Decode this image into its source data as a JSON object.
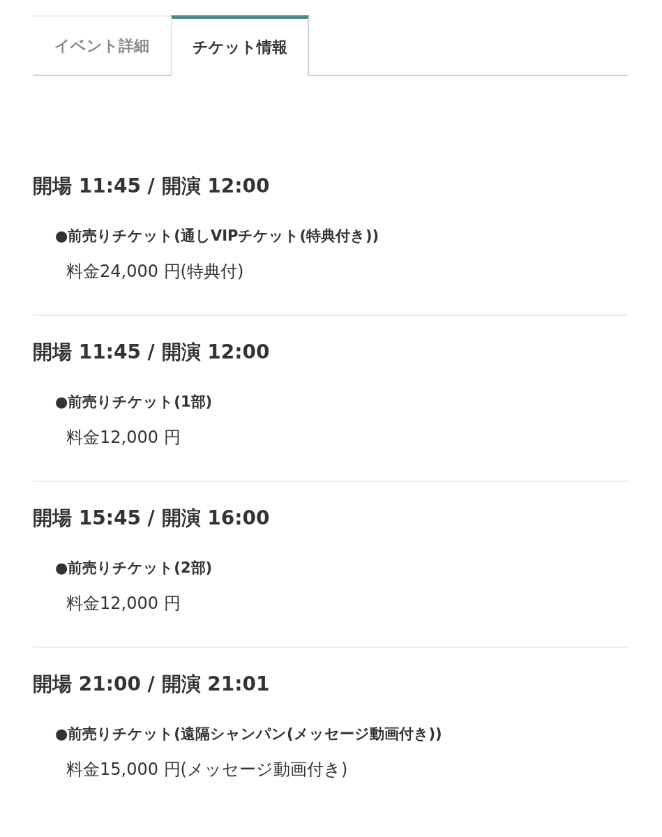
{
  "tabs": [
    {
      "label": "イベント詳細",
      "selected": false
    },
    {
      "label": "チケット情報",
      "selected": true
    }
  ],
  "sessions": [
    {
      "time": "開場 11:45 / 開演 12:00",
      "ticket": "●前売りチケット(通しVIPチケット(特典付き))",
      "price": "料金24,000 円(特典付)"
    },
    {
      "time": "開場 11:45 / 開演 12:00",
      "ticket": "●前売りチケット(1部)",
      "price": "料金12,000 円"
    },
    {
      "time": "開場 15:45 / 開演 16:00",
      "ticket": "●前売りチケット(2部)",
      "price": "料金12,000 円"
    },
    {
      "time": "開場 21:00 / 開演 21:01",
      "ticket": "●前売りチケット(遠隔シャンパン(メッセージ動画付き))",
      "price": "料金15,000 円(メッセージ動画付き)"
    }
  ]
}
